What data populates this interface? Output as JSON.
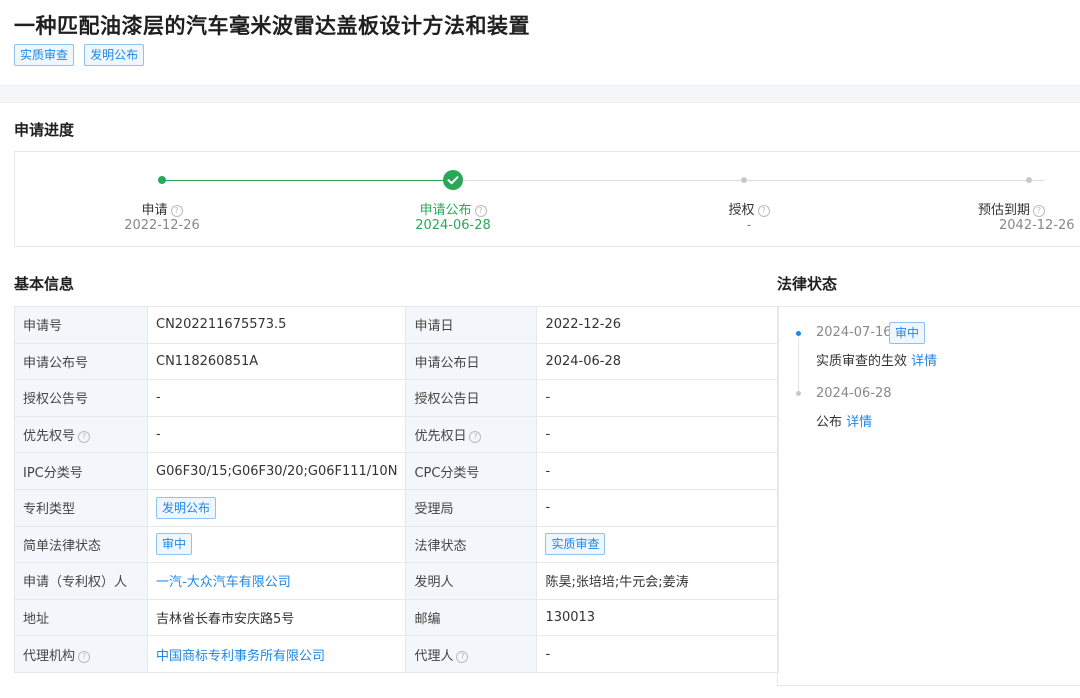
{
  "title": "一种匹配油漆层的汽车毫米波雷达盖板设计方法和装置",
  "header_tags": [
    "实质审查",
    "发明公布"
  ],
  "progress": {
    "section_title": "申请进度",
    "steps": [
      {
        "label": "申请",
        "date": "2022-12-26",
        "state": "done"
      },
      {
        "label": "申请公布",
        "date": "2024-06-28",
        "state": "current"
      },
      {
        "label": "授权",
        "date": "-",
        "state": "pending"
      },
      {
        "label": "预估到期",
        "date": "2042-12-26",
        "state": "pending"
      }
    ],
    "colors": {
      "done": "#2aa85a",
      "pending": "#c8c8c8"
    }
  },
  "basic_info": {
    "section_title": "基本信息",
    "rows": [
      {
        "k1": "申请号",
        "v1": "CN202211675573.5",
        "k2": "申请日",
        "v2": "2022-12-26"
      },
      {
        "k1": "申请公布号",
        "v1": "CN118260851A",
        "k2": "申请公布日",
        "v2": "2024-06-28"
      },
      {
        "k1": "授权公告号",
        "v1": "-",
        "k2": "授权公告日",
        "v2": "-"
      },
      {
        "k1": "优先权号",
        "v1": "-",
        "k2": "优先权日",
        "v2": "-"
      },
      {
        "k1": "IPC分类号",
        "v1": "G06F30/15;G06F30/20;G06F111/10N",
        "k2": "CPC分类号",
        "v2": "-"
      },
      {
        "k1": "专利类型",
        "v1": "发明公布",
        "k2": "受理局",
        "v2": "-"
      },
      {
        "k1": "简单法律状态",
        "v1": "审中",
        "k2": "法律状态",
        "v2": "实质审查"
      },
      {
        "k1": "申请（专利权）人",
        "v1": "一汽-大众汽车有限公司",
        "k2": "发明人",
        "v2": "陈昊;张培培;牛元会;姜涛"
      },
      {
        "k1": "地址",
        "v1": "吉林省长春市安庆路5号",
        "k2": "邮编",
        "v2": "130013"
      },
      {
        "k1": "代理机构",
        "v1": "中国商标专利事务所有限公司",
        "k2": "代理人",
        "v2": "-"
      }
    ]
  },
  "legal_status": {
    "section_title": "法律状态",
    "events": [
      {
        "date": "2024-07-16",
        "badge": "审中",
        "text": "实质审查的生效",
        "link": "详情"
      },
      {
        "date": "2024-06-28",
        "text": "公布",
        "link": "详情"
      }
    ]
  },
  "help_icon": "question-circle-icon"
}
